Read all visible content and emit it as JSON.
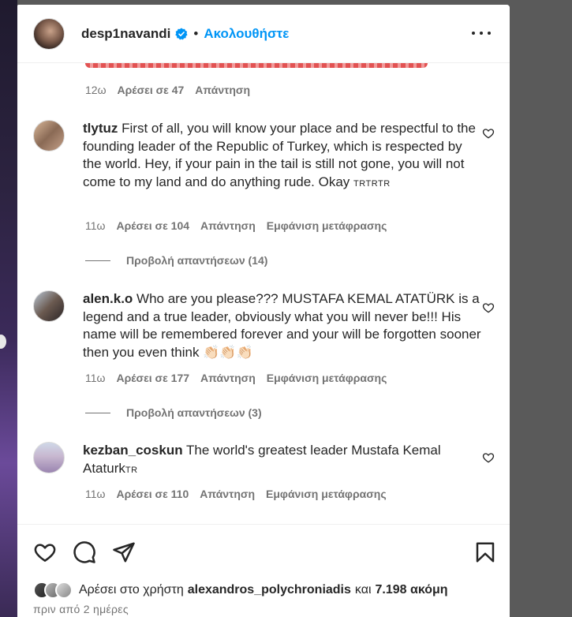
{
  "header": {
    "username": "desp1navandi",
    "separator": "•",
    "follow_label": "Ακολουθήστε"
  },
  "comments": [
    {
      "meta": {
        "time": "12ω",
        "likes": "Αρέσει σε 47",
        "reply": "Απάντηση"
      }
    },
    {
      "username": "tlytuz",
      "text": "First of all, you will know your place and be respectful to the founding leader of the Republic of Turkey, which is respected by the world. Hey, if your pain in the tail is still not gone, you will not come to my land and do anything rude. Okay",
      "suffix": "TRTRTR",
      "meta": {
        "time": "11ω",
        "likes": "Αρέσει σε 104",
        "reply": "Απάντηση",
        "translate": "Εμφάνιση μετάφρασης"
      },
      "view_replies": "Προβολή απαντήσεων (14)"
    },
    {
      "username": "alen.k.o",
      "text": "Who are you please??? MUSTAFA KEMAL ATATÜRK is a legend and a true leader, obviously what you will never be!!! His name will be remembered forever and your will be forgotten sooner then you even think",
      "emoji": "👏🏻👏🏻👏🏻",
      "meta": {
        "time": "11ω",
        "likes": "Αρέσει σε 177",
        "reply": "Απάντηση",
        "translate": "Εμφάνιση μετάφρασης"
      },
      "view_replies": "Προβολή απαντήσεων (3)"
    },
    {
      "username": "kezban_coskun",
      "text": "The world's greatest leader Mustafa Kemal Ataturk",
      "suffix": "TR",
      "meta": {
        "time": "11ω",
        "likes": "Αρέσει σε 110",
        "reply": "Απάντηση",
        "translate": "Εμφάνιση μετάφρασης"
      }
    }
  ],
  "likes_bar": {
    "prefix": "Αρέσει στο χρήστη",
    "user": "alexandros_polychroniadis",
    "and": "και",
    "count": "7.198 ακόμη"
  },
  "timestamp": "πριν από 2 ημέρες",
  "icons": {
    "verified": "verified-badge-icon",
    "more": "more-options-icon",
    "like": "heart-icon",
    "comment": "comment-icon",
    "share": "share-icon",
    "save": "bookmark-icon"
  },
  "colors": {
    "accent": "#0095f6",
    "muted": "#737373",
    "text": "#262626"
  }
}
